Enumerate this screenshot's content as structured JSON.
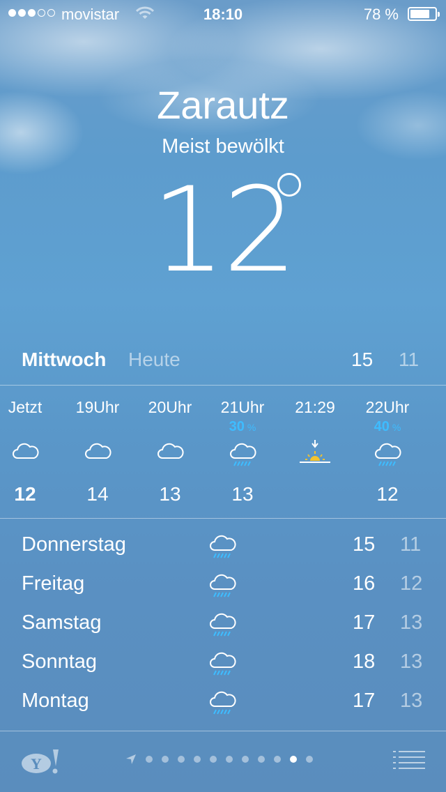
{
  "status_bar": {
    "signal_filled": 3,
    "signal_total": 5,
    "carrier": "movistar",
    "time": "18:10",
    "battery_text": "78 %",
    "battery_level": 0.78
  },
  "location": {
    "city": "Zarautz",
    "condition": "Meist bewölkt",
    "temperature": "12"
  },
  "today": {
    "day": "Mittwoch",
    "relative": "Heute",
    "high": "15",
    "low": "11"
  },
  "hourly": [
    {
      "label": "Jetzt",
      "icon": "cloud-icon",
      "temp": "12",
      "bold": true
    },
    {
      "label": "19Uhr",
      "icon": "cloud-icon",
      "temp": "14"
    },
    {
      "label": "20Uhr",
      "icon": "cloud-icon",
      "temp": "13"
    },
    {
      "label": "21Uhr",
      "precip": "30",
      "precip_unit": "%",
      "icon": "rain-cloud-icon",
      "temp": "13"
    },
    {
      "label": "21:29",
      "icon": "sunset-icon",
      "temp": ""
    },
    {
      "label": "22Uhr",
      "precip": "40",
      "precip_unit": "%",
      "icon": "rain-cloud-icon",
      "temp": "12"
    }
  ],
  "daily": [
    {
      "day": "Donnerstag",
      "icon": "rain-cloud-icon",
      "high": "15",
      "low": "11"
    },
    {
      "day": "Freitag",
      "icon": "rain-cloud-icon",
      "high": "16",
      "low": "12"
    },
    {
      "day": "Samstag",
      "icon": "rain-cloud-icon",
      "high": "17",
      "low": "13"
    },
    {
      "day": "Sonntag",
      "icon": "rain-cloud-icon",
      "high": "18",
      "low": "13"
    },
    {
      "day": "Montag",
      "icon": "rain-cloud-icon",
      "high": "17",
      "low": "13"
    }
  ],
  "footer": {
    "logo": "yahoo-logo",
    "page_count": 11,
    "active_page": 10,
    "menu_icon": "list-icon"
  },
  "colors": {
    "precip_accent": "#3ebcff",
    "sun_accent": "#f2c32e"
  }
}
